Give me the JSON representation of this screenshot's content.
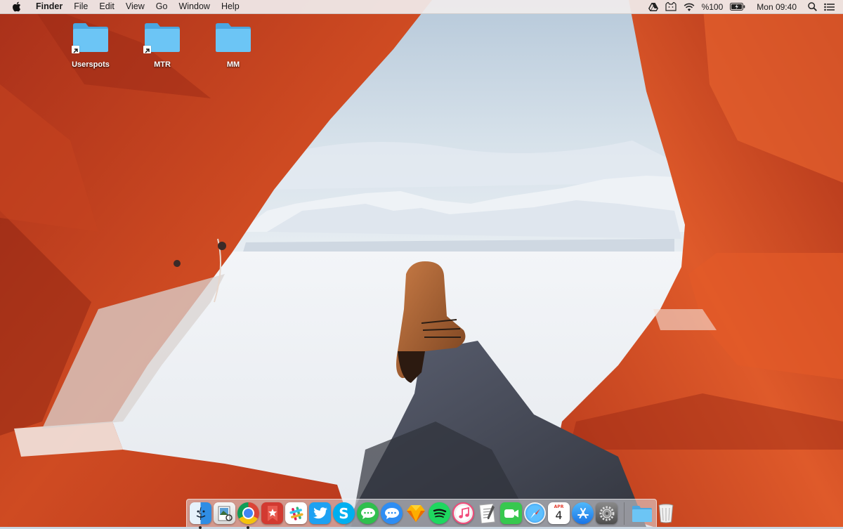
{
  "menubar": {
    "app_name": "Finder",
    "menus": [
      "File",
      "Edit",
      "View",
      "Go",
      "Window",
      "Help"
    ],
    "battery_text": "%100",
    "clock": "Mon 09:40"
  },
  "desktop": {
    "icons": [
      {
        "label": "Userspots",
        "alias": true
      },
      {
        "label": "MTR",
        "alias": true
      },
      {
        "label": "MM",
        "alias": false
      }
    ]
  },
  "dock": {
    "apps": [
      {
        "name": "Finder",
        "icon": "finder-icon",
        "running": true
      },
      {
        "name": "Preview",
        "icon": "preview-icon",
        "running": false
      },
      {
        "name": "Google Chrome",
        "icon": "chrome-icon",
        "running": true
      },
      {
        "name": "Wunderlist",
        "icon": "wunderlist-icon",
        "running": false
      },
      {
        "name": "Slack",
        "icon": "slack-icon",
        "running": false
      },
      {
        "name": "Twitter",
        "icon": "twitter-icon",
        "running": false
      },
      {
        "name": "Skype",
        "icon": "skype-icon",
        "running": false
      },
      {
        "name": "Messages",
        "icon": "messages-green-icon",
        "running": false
      },
      {
        "name": "Messages",
        "icon": "messages-blue-icon",
        "running": false
      },
      {
        "name": "Sketch",
        "icon": "sketch-icon",
        "running": false
      },
      {
        "name": "Spotify",
        "icon": "spotify-icon",
        "running": false
      },
      {
        "name": "iTunes",
        "icon": "itunes-icon",
        "running": false
      },
      {
        "name": "TextEdit",
        "icon": "textedit-icon",
        "running": false
      },
      {
        "name": "FaceTime",
        "icon": "facetime-icon",
        "running": false
      },
      {
        "name": "Safari",
        "icon": "safari-icon",
        "running": false
      },
      {
        "name": "Calendar",
        "icon": "calendar-icon",
        "running": false
      },
      {
        "name": "App Store",
        "icon": "appstore-icon",
        "running": false
      },
      {
        "name": "System Preferences",
        "icon": "system-preferences-icon",
        "running": false
      },
      {
        "name": "Downloads",
        "icon": "downloads-folder-icon",
        "running": false
      },
      {
        "name": "Trash",
        "icon": "trash-icon",
        "running": false
      }
    ],
    "calendar": {
      "month": "APR",
      "day": "4"
    }
  },
  "colors": {
    "tent": "#c8421c",
    "folder": "#5ab8ef",
    "sky": "#c9d8e6"
  }
}
